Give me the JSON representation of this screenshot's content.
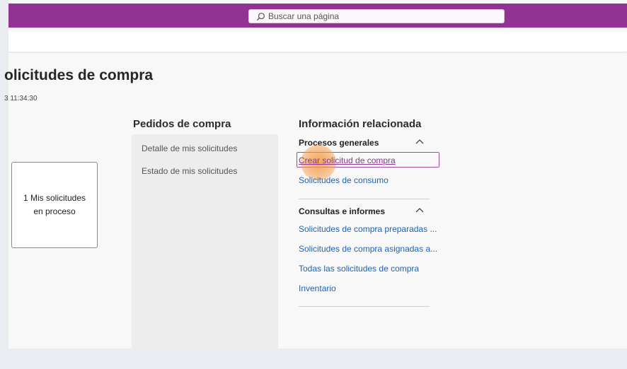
{
  "header": {
    "search_placeholder": "Buscar una página"
  },
  "page": {
    "title": "olicitudes de compra",
    "timestamp": "3 11:34:30"
  },
  "tile": {
    "label": "1 Mis solicitudes en proceso"
  },
  "orders": {
    "heading": "Pedidos de compra",
    "links": [
      "Detalle de mis solicitudes",
      "Estado de mis solicitudes"
    ]
  },
  "related": {
    "heading": "Información relacionada",
    "groups": [
      {
        "title": "Procesos generales",
        "links": [
          "Crear solicitud de compra",
          "Solicitudes de consumo"
        ]
      },
      {
        "title": "Consultas e informes",
        "links": [
          "Solicitudes de compra preparadas ...",
          "Solicitudes de compra asignadas a...",
          "Todas las solicitudes de compra",
          "Inventario"
        ]
      }
    ]
  },
  "colors": {
    "brand": "#923292",
    "link": "#1f62b3",
    "focus": "#a04aa0"
  }
}
